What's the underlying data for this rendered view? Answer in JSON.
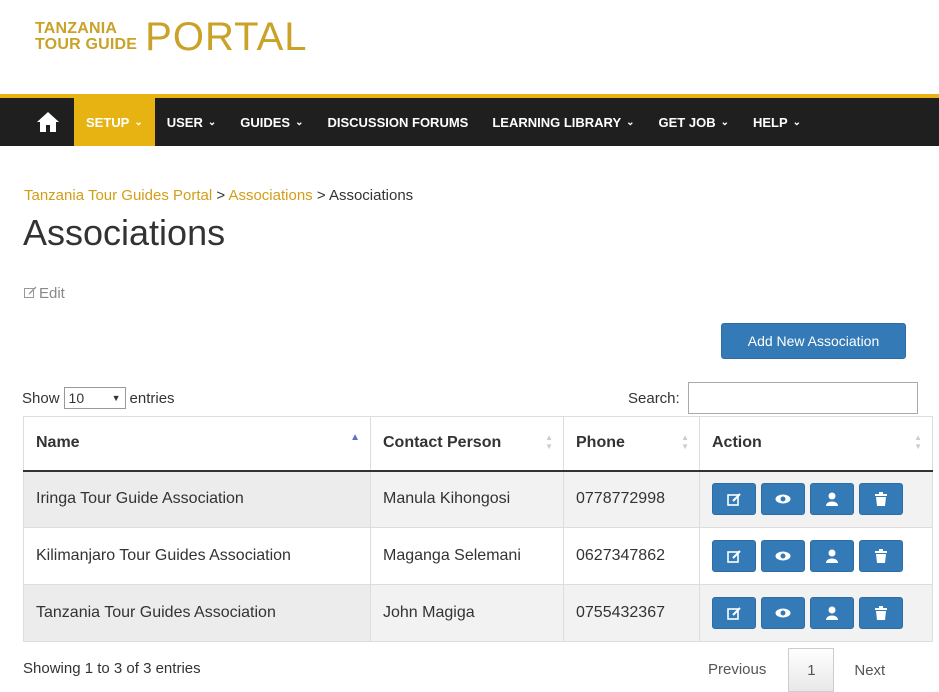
{
  "logo": {
    "line1": "TANZANIA",
    "line2": "TOUR GUIDE",
    "big": "PORTAL"
  },
  "nav": {
    "items": [
      {
        "label": "SETUP",
        "chev": "⌄"
      },
      {
        "label": "USER",
        "chev": "⌄"
      },
      {
        "label": "GUIDES",
        "chev": "⌄"
      },
      {
        "label": "DISCUSSION FORUMS",
        "chev": ""
      },
      {
        "label": "LEARNING LIBRARY",
        "chev": "⌄"
      },
      {
        "label": "GET JOB",
        "chev": "⌄"
      },
      {
        "label": "HELP",
        "chev": "⌄"
      }
    ]
  },
  "breadcrumb": {
    "home": "Tanzania Tour Guides Portal",
    "section": "Associations",
    "sep": " > ",
    "current": "Associations"
  },
  "page": {
    "title": "Associations",
    "edit": "Edit",
    "add_button": "Add New Association"
  },
  "controls": {
    "show": "Show",
    "entries_value": "10",
    "entries": "entries",
    "search_label": "Search:",
    "search_value": ""
  },
  "table": {
    "headers": [
      "Name",
      "Contact Person",
      "Phone",
      "Action"
    ],
    "rows": [
      {
        "name": "Iringa Tour Guide Association",
        "contact": "Manula Kihongosi",
        "phone": "0778772998"
      },
      {
        "name": "Kilimanjaro Tour Guides Association",
        "contact": "Maganga Selemani",
        "phone": "0627347862"
      },
      {
        "name": "Tanzania Tour Guides Association",
        "contact": "John Magiga",
        "phone": "0755432367"
      }
    ]
  },
  "footer": {
    "info": "Showing 1 to 3 of 3 entries",
    "prev": "Previous",
    "page": "1",
    "next": "Next"
  },
  "colors": {
    "accent": "#e6b312",
    "nav_bg": "#1f1f1f",
    "primary": "#337ab7",
    "link": "#d39e15"
  }
}
